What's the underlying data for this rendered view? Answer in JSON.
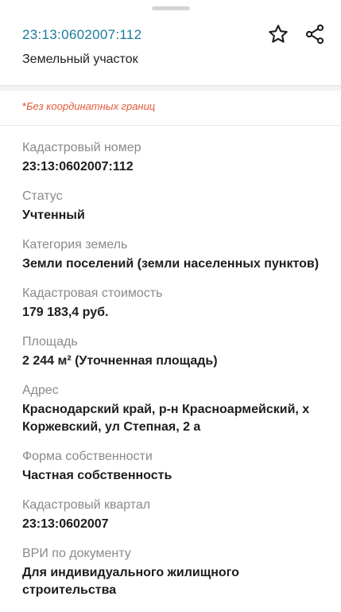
{
  "header": {
    "cadastral_link": "23:13:0602007:112",
    "subtitle": "Земельный участок"
  },
  "warning": {
    "mark": "*",
    "text": "Без координатных границ"
  },
  "fields": [
    {
      "label": "Кадастровый номер",
      "value": "23:13:0602007:112"
    },
    {
      "label": "Статус",
      "value": "Учтенный"
    },
    {
      "label": "Категория земель",
      "value": "Земли поселений (земли населенных пунктов)"
    },
    {
      "label": "Кадастровая стоимость",
      "value": "179 183,4 руб."
    },
    {
      "label": "Площадь",
      "value": "2 244 м² (Уточненная площадь)"
    },
    {
      "label": "Адрес",
      "value": "Краснодарский край, р-н Красноармейский, х Коржевский, ул Степная, 2 а"
    },
    {
      "label": "Форма собственности",
      "value": "Частная собственность"
    },
    {
      "label": "Кадастровый квартал",
      "value": "23:13:0602007"
    },
    {
      "label": "ВРИ по документу",
      "value": "Для индивидуального жилищного строительства"
    }
  ],
  "icons": {
    "favorite": "star-icon",
    "share": "share-icon"
  },
  "colors": {
    "link": "#1a7a9c",
    "warning": "#e05a3a"
  }
}
